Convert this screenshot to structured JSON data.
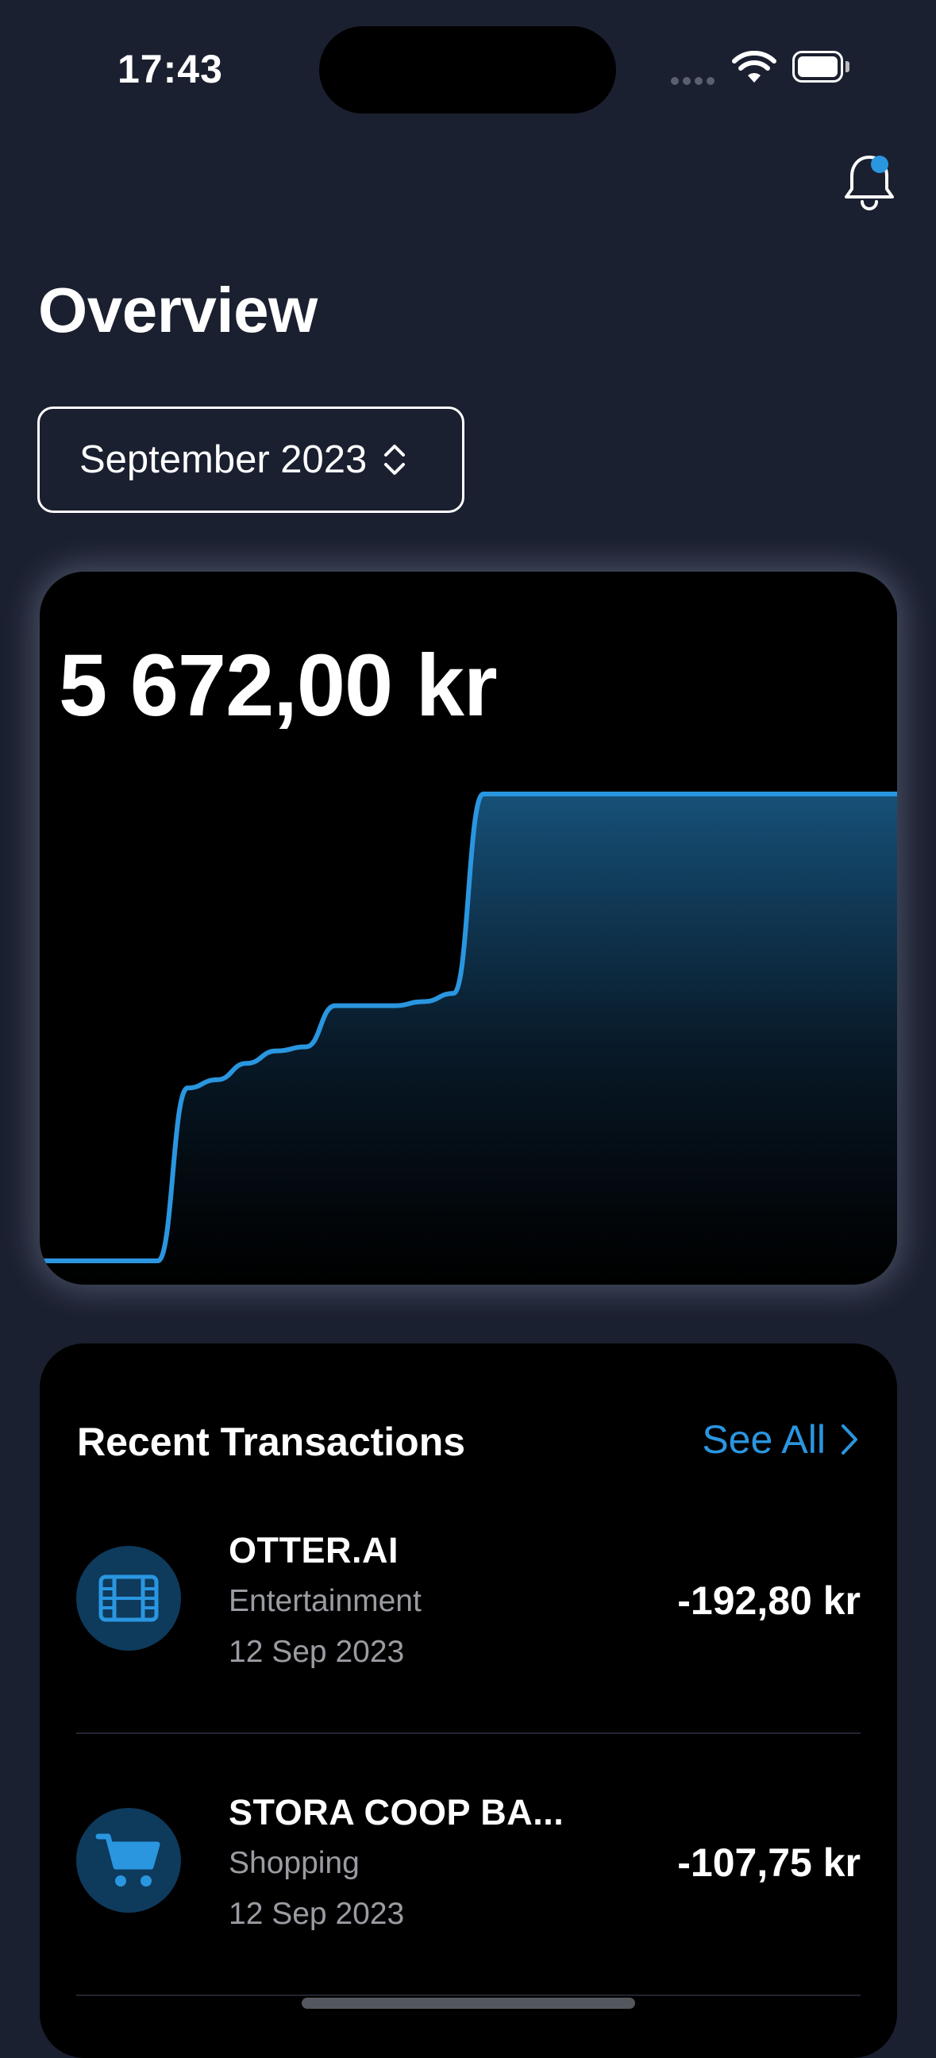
{
  "status_bar": {
    "time": "17:43"
  },
  "header": {
    "title": "Overview"
  },
  "month_picker": {
    "label": "September 2023"
  },
  "summary": {
    "total": "5 672,00 kr",
    "accent_color": "#2a96e0"
  },
  "chart_data": {
    "type": "area",
    "x": [
      1,
      2,
      3,
      4,
      5,
      6,
      7,
      8,
      9,
      10,
      11,
      12,
      13,
      14,
      15,
      16,
      17,
      18,
      19,
      20,
      21,
      22,
      23,
      24,
      25,
      26,
      27,
      28,
      29,
      30
    ],
    "values": [
      0,
      0,
      0,
      0,
      0,
      2100,
      2200,
      2400,
      2550,
      2600,
      3100,
      3100,
      3100,
      3150,
      3250,
      5672,
      5672,
      5672,
      5672,
      5672,
      5672,
      5672,
      5672,
      5672,
      5672,
      5672,
      5672,
      5672,
      5672,
      5672
    ],
    "ylim": [
      0,
      5672
    ],
    "title": "",
    "xlabel": "",
    "ylabel": ""
  },
  "transactions": {
    "title": "Recent Transactions",
    "see_all": "See All",
    "items": [
      {
        "name": "OTTER.AI",
        "category": "Entertainment",
        "date": "12 Sep 2023",
        "amount": "-192,80 kr",
        "icon": "film-icon"
      },
      {
        "name": "STORA COOP BA...",
        "category": "Shopping",
        "date": "12 Sep 2023",
        "amount": "-107,75 kr",
        "icon": "cart-icon"
      }
    ]
  }
}
